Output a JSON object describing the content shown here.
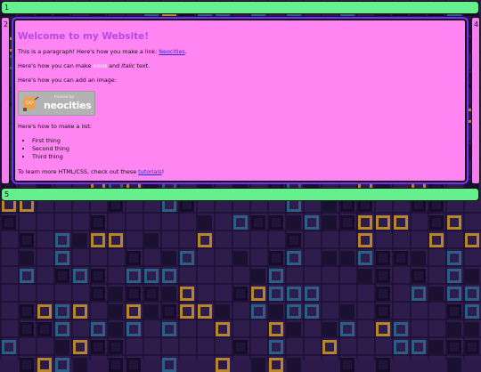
{
  "header": {
    "label": "1"
  },
  "left_panel": {
    "label": "2"
  },
  "right_panel": {
    "label": "4"
  },
  "footer": {
    "label": "5"
  },
  "main": {
    "heading": "Welcome to my Website!",
    "para1_prefix": "This is a paragraph! Here's how you make a link: ",
    "para1_link": "Neocities",
    "para1_suffix": ".",
    "para2_prefix": "Here's how you can make ",
    "para2_bold": "bold",
    "para2_middle": " and ",
    "para2_italic": "italic",
    "para2_suffix": " text.",
    "para3": "Here's how you can add an image:",
    "badge": {
      "small": "hosted by",
      "brand": "neocities"
    },
    "para4": "Here's how to make a list:",
    "list": [
      "First thing",
      "Second thing",
      "Third thing"
    ],
    "para5_prefix": "To learn more HTML/CSS, check out these ",
    "para5_link": "tutorials",
    "para5_suffix": "!"
  },
  "colors": {
    "bar_green": "#66f08d",
    "panel_pink": "#ff85f3",
    "heading_purple": "#b04be8",
    "background_purple": "#2e1c4d"
  }
}
